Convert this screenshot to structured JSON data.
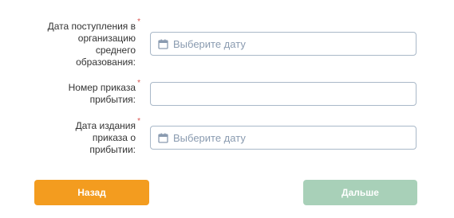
{
  "form": {
    "fields": [
      {
        "label": "Дата поступления в организацию среднего образования:",
        "required_mark": "*",
        "type": "date",
        "placeholder": "Выберите дату",
        "icon": "calendar-icon"
      },
      {
        "label": "Номер приказа прибытия:",
        "required_mark": "*",
        "type": "text",
        "value": ""
      },
      {
        "label": "Дата издания приказа о прибытии:",
        "required_mark": "*",
        "type": "date",
        "placeholder": "Выберите дату",
        "icon": "calendar-icon"
      }
    ]
  },
  "buttons": {
    "back_label": "Назад",
    "next_label": "Дальше"
  },
  "colors": {
    "back_button": "#f39c1f",
    "next_button_disabled": "#a8d0b8",
    "required_star": "#d9534f",
    "input_border": "#a9b8c8",
    "placeholder": "#8a9bb0"
  }
}
